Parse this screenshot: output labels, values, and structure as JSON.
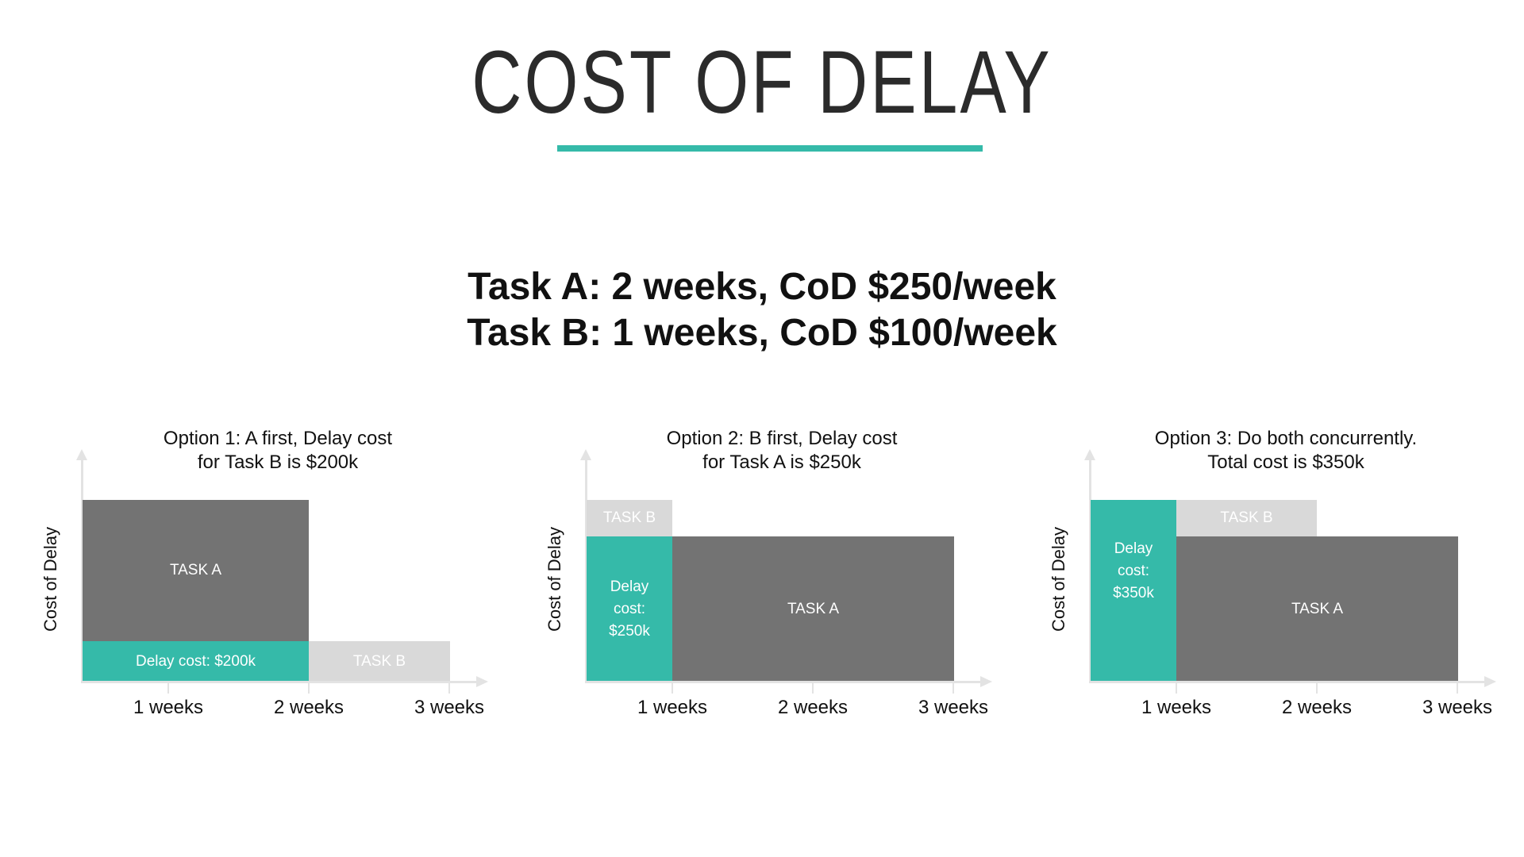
{
  "header": {
    "title": "COST OF DELAY",
    "line1": "Task A: 2 weeks, CoD $250/week",
    "line2": "Task B: 1 weeks, CoD $100/week"
  },
  "colors": {
    "accent": "#35baa9",
    "task_dark": "#737373",
    "task_light": "#d9d9d9",
    "axis": "#e3e3e3"
  },
  "options": [
    {
      "caption_line1": "Option 1: A first, Delay cost",
      "caption_line2": "for Task B is $200k",
      "ylabel": "Cost of Delay",
      "ticks": [
        "1 weeks",
        "2 weeks",
        "3 weeks"
      ],
      "blocks": {
        "task_a": "TASK A",
        "delay": "Delay cost: $200k",
        "task_b": "TASK B"
      }
    },
    {
      "caption_line1": "Option 2: B first, Delay cost",
      "caption_line2": "for Task A is $250k",
      "ylabel": "Cost of Delay",
      "ticks": [
        "1 weeks",
        "2 weeks",
        "3 weeks"
      ],
      "blocks": {
        "task_b": "TASK B",
        "delay_l1": "Delay",
        "delay_l2": "cost:",
        "delay_l3": "$250k",
        "task_a": "TASK A"
      }
    },
    {
      "caption_line1": "Option 3: Do both concurrently.",
      "caption_line2": "Total cost is $350k",
      "ylabel": "Cost of Delay",
      "ticks": [
        "1 weeks",
        "2 weeks",
        "3 weeks"
      ],
      "blocks": {
        "delay_l1": "Delay",
        "delay_l2": "cost:",
        "delay_l3": "$350k",
        "task_b": "TASK B",
        "task_a": "TASK A"
      }
    }
  ]
}
